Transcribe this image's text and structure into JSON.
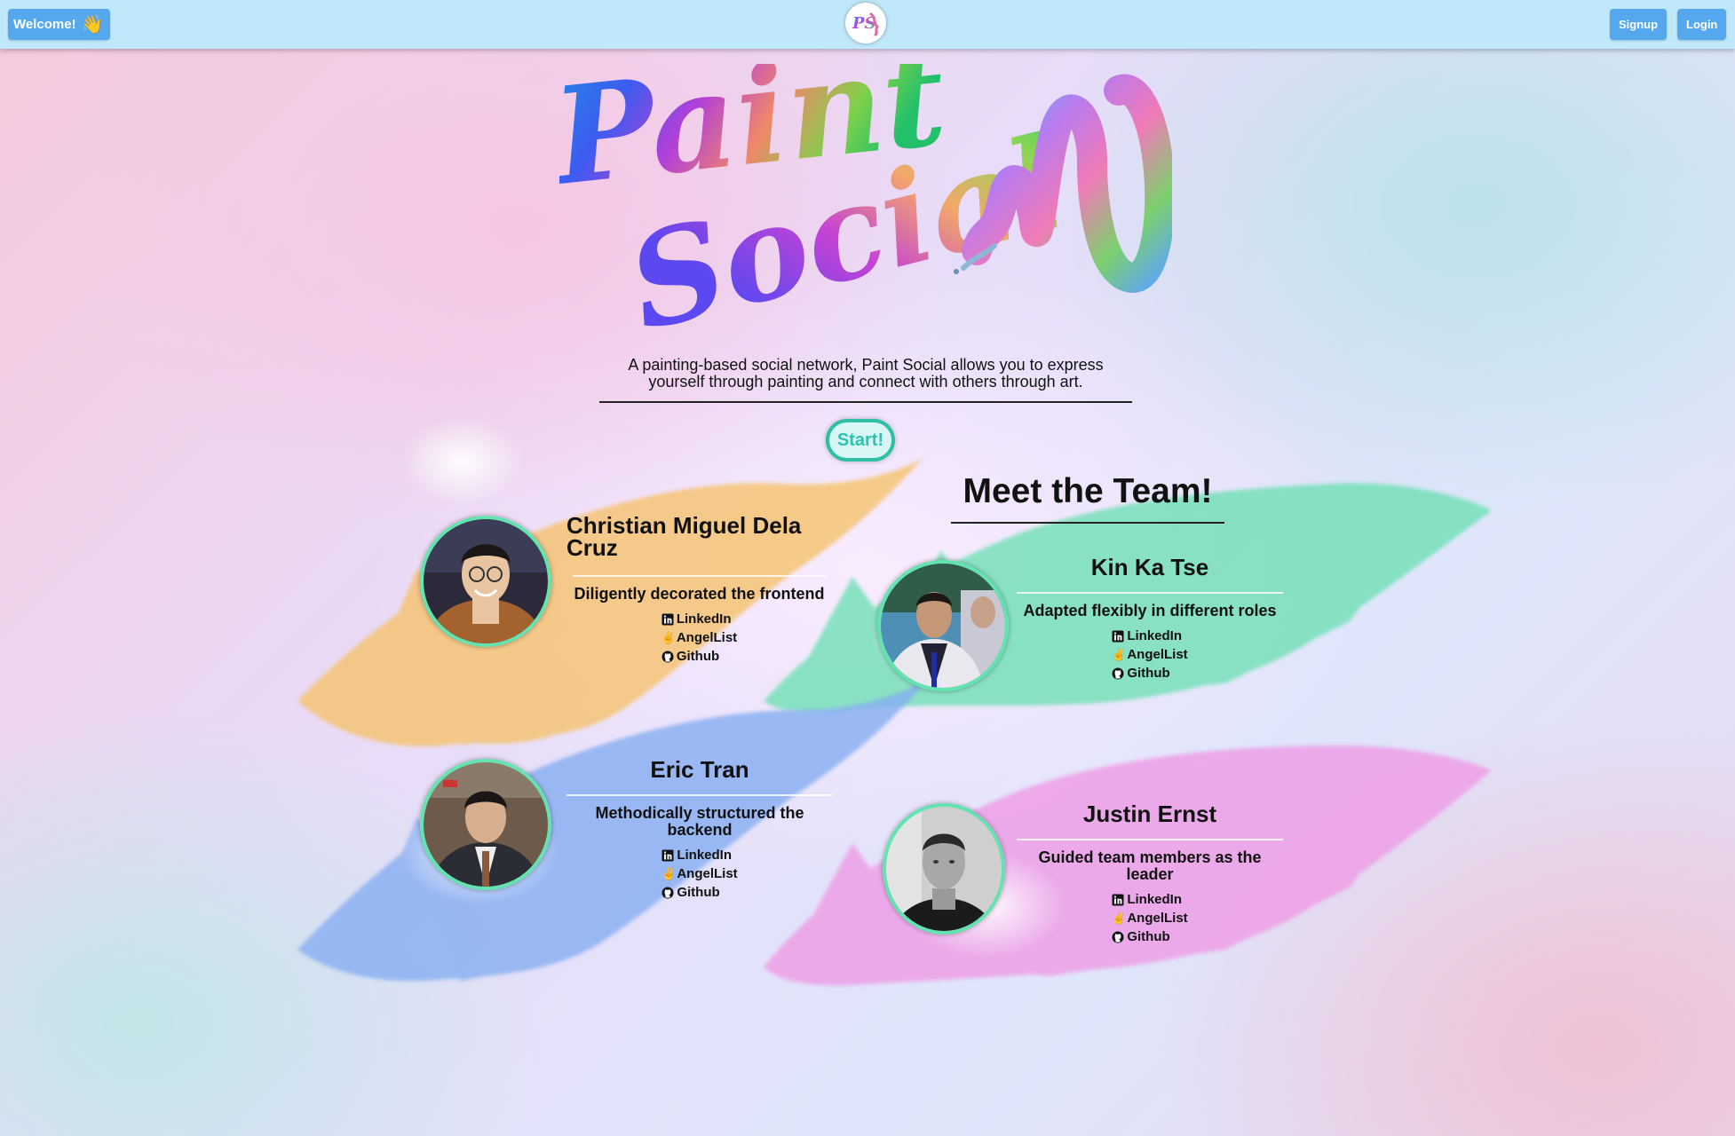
{
  "header": {
    "welcome_label": "Welcome!",
    "nav_logo_text": "PS",
    "signup_label": "Signup",
    "login_label": "Login"
  },
  "hero": {
    "logo_line1": "Paint",
    "logo_line2": "Social",
    "tagline": "A painting-based social network, Paint Social allows you to express yourself through painting and connect with others through art.",
    "start_label": "Start!"
  },
  "team": {
    "heading": "Meet the Team!",
    "members": [
      {
        "name": "Christian Miguel Dela Cruz",
        "role": "Diligently decorated the frontend",
        "links": [
          "LinkedIn",
          "AngelList",
          "Github"
        ]
      },
      {
        "name": "Kin Ka Tse",
        "role": "Adapted flexibly in different roles",
        "links": [
          "LinkedIn",
          "AngelList",
          "Github"
        ]
      },
      {
        "name": "Eric Tran",
        "role": "Methodically structured the backend",
        "links": [
          "LinkedIn",
          "AngelList",
          "Github"
        ]
      },
      {
        "name": "Justin Ernst",
        "role": "Guided team members as the leader",
        "links": [
          "LinkedIn",
          "AngelList",
          "Github"
        ]
      }
    ]
  },
  "colors": {
    "header_bg": "#bfe9fb",
    "button_blue": "#55a8ee",
    "avatar_ring": "#63e3b0",
    "start_border": "#2fbfa3",
    "stroke_orange": "#f6c36d",
    "stroke_green": "#6fe0b5",
    "stroke_blue": "#86aef2",
    "stroke_pink": "#ef9be6"
  }
}
